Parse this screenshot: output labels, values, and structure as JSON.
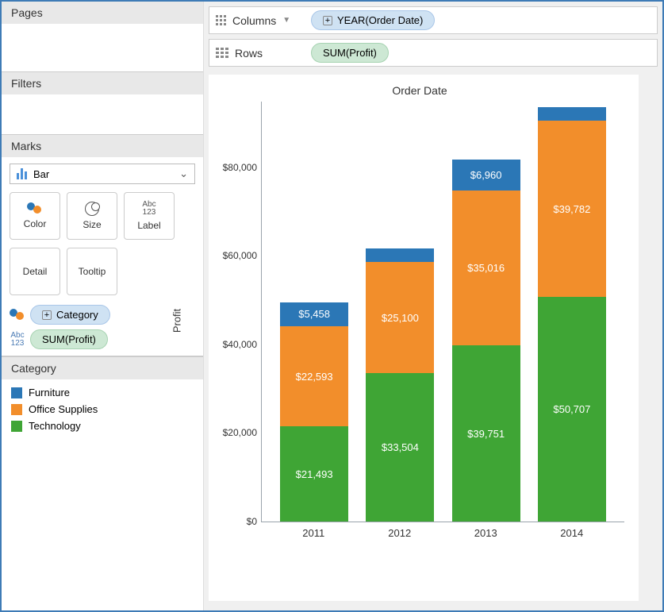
{
  "sidebar": {
    "pages_label": "Pages",
    "filters_label": "Filters",
    "marks_label": "Marks",
    "mark_type": "Bar",
    "mark_cards": {
      "color": "Color",
      "size": "Size",
      "label": "Label",
      "detail": "Detail",
      "tooltip": "Tooltip"
    },
    "mark_pills": {
      "color_field": "Category",
      "label_field": "SUM(Profit)"
    }
  },
  "legend": {
    "title": "Category",
    "items": [
      {
        "name": "Furniture",
        "color": "#2b77b6"
      },
      {
        "name": "Office Supplies",
        "color": "#f28e2b"
      },
      {
        "name": "Technology",
        "color": "#3fa535"
      }
    ]
  },
  "shelves": {
    "columns_label": "Columns",
    "columns_pill": "YEAR(Order Date)",
    "rows_label": "Rows",
    "rows_pill": "SUM(Profit)"
  },
  "chart_data": {
    "type": "bar",
    "title": "Order Date",
    "ylabel": "Profit",
    "xlabel": "",
    "categories": [
      "2011",
      "2012",
      "2013",
      "2014"
    ],
    "series": [
      {
        "name": "Technology",
        "color": "#3fa535",
        "values": [
          21493,
          33504,
          39751,
          50707
        ]
      },
      {
        "name": "Office Supplies",
        "color": "#f28e2b",
        "values": [
          22593,
          25100,
          35016,
          39782
        ]
      },
      {
        "name": "Furniture",
        "color": "#2b77b6",
        "values": [
          5458,
          3100,
          6960,
          3000
        ]
      }
    ],
    "value_labels": [
      [
        "$21,493",
        "$22,593",
        "$5,458"
      ],
      [
        "$33,504",
        "$25,100",
        ""
      ],
      [
        "$39,751",
        "$35,016",
        "$6,960"
      ],
      [
        "$50,707",
        "$39,782",
        ""
      ]
    ],
    "yticks": [
      0,
      20000,
      40000,
      60000,
      80000
    ],
    "ytick_labels": [
      "$0",
      "$20,000",
      "$40,000",
      "$60,000",
      "$80,000"
    ],
    "ylim": [
      0,
      95000
    ]
  },
  "label_icon_text": "Abc\n123"
}
